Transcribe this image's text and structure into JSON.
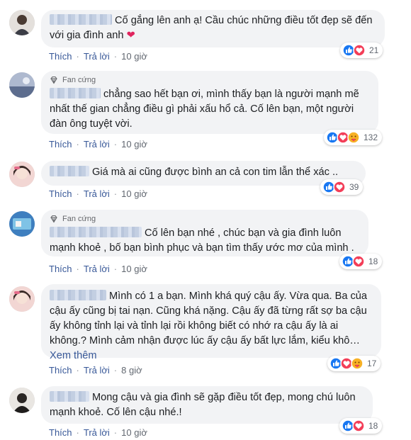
{
  "actions": {
    "like": "Thích",
    "reply": "Trả lời",
    "dot": "·"
  },
  "comments": [
    {
      "badge": "",
      "text": "Cố gắng lên anh ạ! Cầu chúc những điều tốt đẹp sẽ đến với gia đình anh",
      "time": "10 giờ",
      "reaction_count": "21",
      "reactions": [
        "like",
        "love"
      ]
    },
    {
      "badge": "Fan cứng",
      "text": "chẳng sao hết bạn ơi, mình thấy bạn là người mạnh mẽ nhất thế gian chẳng điều gì phải xấu hổ cả. Cố lên bạn, một người đàn ông tuyệt vời.",
      "time": "10 giờ",
      "reaction_count": "132",
      "reactions": [
        "like",
        "love",
        "care"
      ]
    },
    {
      "badge": "",
      "text": "Giá mà ai cũng được bình an cả con tim lẫn thể xác ..",
      "time": "10 giờ",
      "reaction_count": "39",
      "reactions": [
        "like",
        "love"
      ]
    },
    {
      "badge": "Fan cứng",
      "text": "Cố lên bạn nhé , chúc bạn và gia đình luôn mạnh khoẻ , bố bạn bình phục và bạn tìm thấy ước mơ của mình .",
      "time": "10 giờ",
      "reaction_count": "18",
      "reactions": [
        "like",
        "love"
      ]
    },
    {
      "badge": "",
      "text": "Mình có 1 a bạn. Mình khá quý cậu ấy. Vừa qua. Ba của cậu ấy cũng bị tai nạn. Cũng khá nặng. Cậu ấy đã từng rất sợ ba cậu ấy không tỉnh lại và tỉnh lại rồi không biết có nhớ ra cậu ấy là ai không.? Mình cảm nhận được lúc ấy cậu ấy bất lực lắm, kiểu khô…",
      "see_more": "Xem thêm",
      "time": "8 giờ",
      "reaction_count": "17",
      "reactions": [
        "like",
        "love",
        "care"
      ]
    },
    {
      "badge": "",
      "text": "Mong cậu và gia đình sẽ gặp điều tốt đẹp, mong chú luôn mạnh khoẻ. Cố lên cậu nhé.!",
      "time": "10 giờ",
      "reaction_count": "18",
      "reactions": [
        "like",
        "love"
      ]
    }
  ],
  "colors": {
    "link": "#385898",
    "like": "#1877f2",
    "love": "#f33e58",
    "care": "#f7b125"
  }
}
